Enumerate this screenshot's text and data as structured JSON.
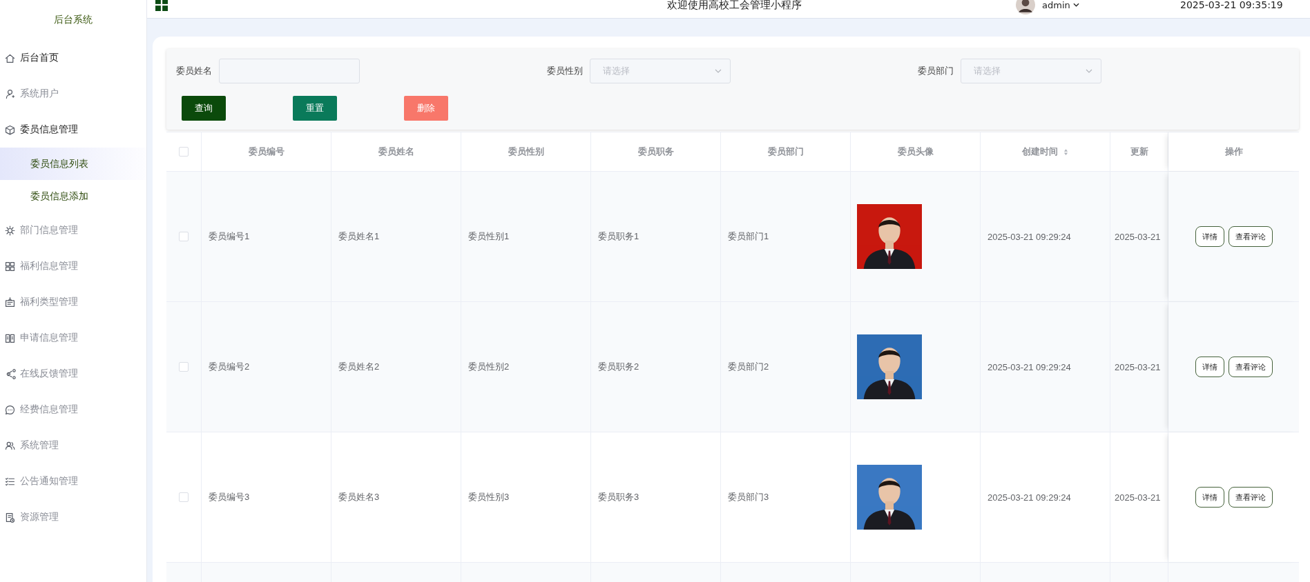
{
  "logo": "后台系统",
  "header": {
    "title": "欢迎使用高校工会管理小程序",
    "user": "admin",
    "datetime": "2025-03-21 09:35:19"
  },
  "sidebar": {
    "items": [
      {
        "label": "后台首页",
        "active": true
      },
      {
        "label": "系统用户",
        "active": false
      },
      {
        "label": "委员信息管理",
        "active": true,
        "expanded": true,
        "children": [
          {
            "label": "委员信息列表",
            "selected": true
          },
          {
            "label": "委员信息添加",
            "selected": false
          }
        ]
      },
      {
        "label": "部门信息管理",
        "active": false
      },
      {
        "label": "福利信息管理",
        "active": false
      },
      {
        "label": "福利类型管理",
        "active": false
      },
      {
        "label": "申请信息管理",
        "active": false
      },
      {
        "label": "在线反馈管理",
        "active": false
      },
      {
        "label": "经费信息管理",
        "active": false
      },
      {
        "label": "系统管理",
        "active": false
      },
      {
        "label": "公告通知管理",
        "active": false
      },
      {
        "label": "资源管理",
        "active": false
      }
    ]
  },
  "filters": [
    {
      "kind": "input",
      "label": "委员姓名"
    },
    {
      "kind": "select",
      "label": "委员性别",
      "placeholder": "请选择"
    },
    {
      "kind": "select",
      "label": "委员部门",
      "placeholder": "请选择"
    }
  ],
  "buttons": [
    {
      "label": "查询",
      "kind": "search"
    },
    {
      "label": "重置",
      "kind": "reset"
    },
    {
      "label": "删除",
      "kind": "delete"
    }
  ],
  "table": {
    "select_all": {
      "checked": false
    },
    "columns": [
      {
        "label": "委员编号"
      },
      {
        "label": "委员姓名"
      },
      {
        "label": "委员性别"
      },
      {
        "label": "委员职务"
      },
      {
        "label": "委员部门"
      },
      {
        "label": "委员头像"
      },
      {
        "label": "创建时间",
        "sortable": true
      },
      {
        "label": "更新"
      }
    ],
    "actions_column": "操作",
    "rows": [
      {
        "checked": false,
        "cells": [
          "委员编号1",
          "委员姓名1",
          "委员性别1",
          "委员职务1",
          "委员部门1",
          {
            "kind": "picture"
          },
          "2025-03-21 09:29:24",
          "2025-03-21"
        ],
        "actions": [
          "详情",
          "查看评论"
        ]
      },
      {
        "checked": false,
        "cells": [
          "委员编号2",
          "委员姓名2",
          "委员性别2",
          "委员职务2",
          "委员部门2",
          {
            "kind": "picture"
          },
          "2025-03-21 09:29:24",
          "2025-03-21"
        ],
        "actions": [
          "详情",
          "查看评论"
        ]
      },
      {
        "checked": false,
        "cells": [
          "委员编号3",
          "委员姓名3",
          "委员性别3",
          "委员职务3",
          "委员部门3",
          {
            "kind": "picture"
          },
          "2025-03-21 09:29:24",
          "2025-03-21"
        ],
        "actions": [
          "详情",
          "查看评论"
        ]
      }
    ]
  }
}
